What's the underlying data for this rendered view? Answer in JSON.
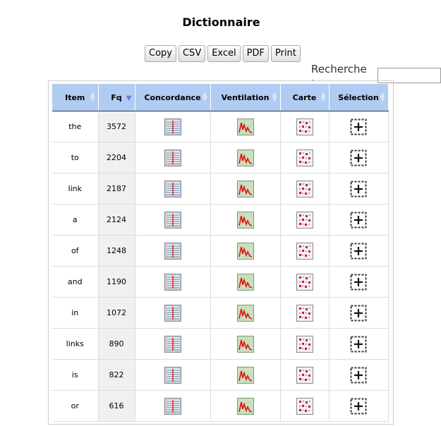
{
  "title": "Dictionnaire",
  "buttons": [
    "Copy",
    "CSV",
    "Excel",
    "PDF",
    "Print"
  ],
  "search": {
    "label": "Recherche :",
    "value": ""
  },
  "columns": [
    "Item",
    "Fq",
    "Concordance",
    "Ventilation",
    "Carte",
    "Sélection"
  ],
  "rows": [
    {
      "item": "the",
      "fq": "3572"
    },
    {
      "item": "to",
      "fq": "2204"
    },
    {
      "item": "link",
      "fq": "2187"
    },
    {
      "item": "a",
      "fq": "2124"
    },
    {
      "item": "of",
      "fq": "1248"
    },
    {
      "item": "and",
      "fq": "1190"
    },
    {
      "item": "in",
      "fq": "1072"
    },
    {
      "item": "links",
      "fq": "890"
    },
    {
      "item": "is",
      "fq": "822"
    },
    {
      "item": "or",
      "fq": "616"
    }
  ],
  "icons": {
    "concordance": "concordance-icon",
    "ventilation": "ventilation-icon",
    "carte": "map-icon",
    "selection": "selection-add-icon"
  },
  "colors": {
    "header_bg": "#b0ccf2",
    "fq_bg": "#f0f0f0"
  }
}
